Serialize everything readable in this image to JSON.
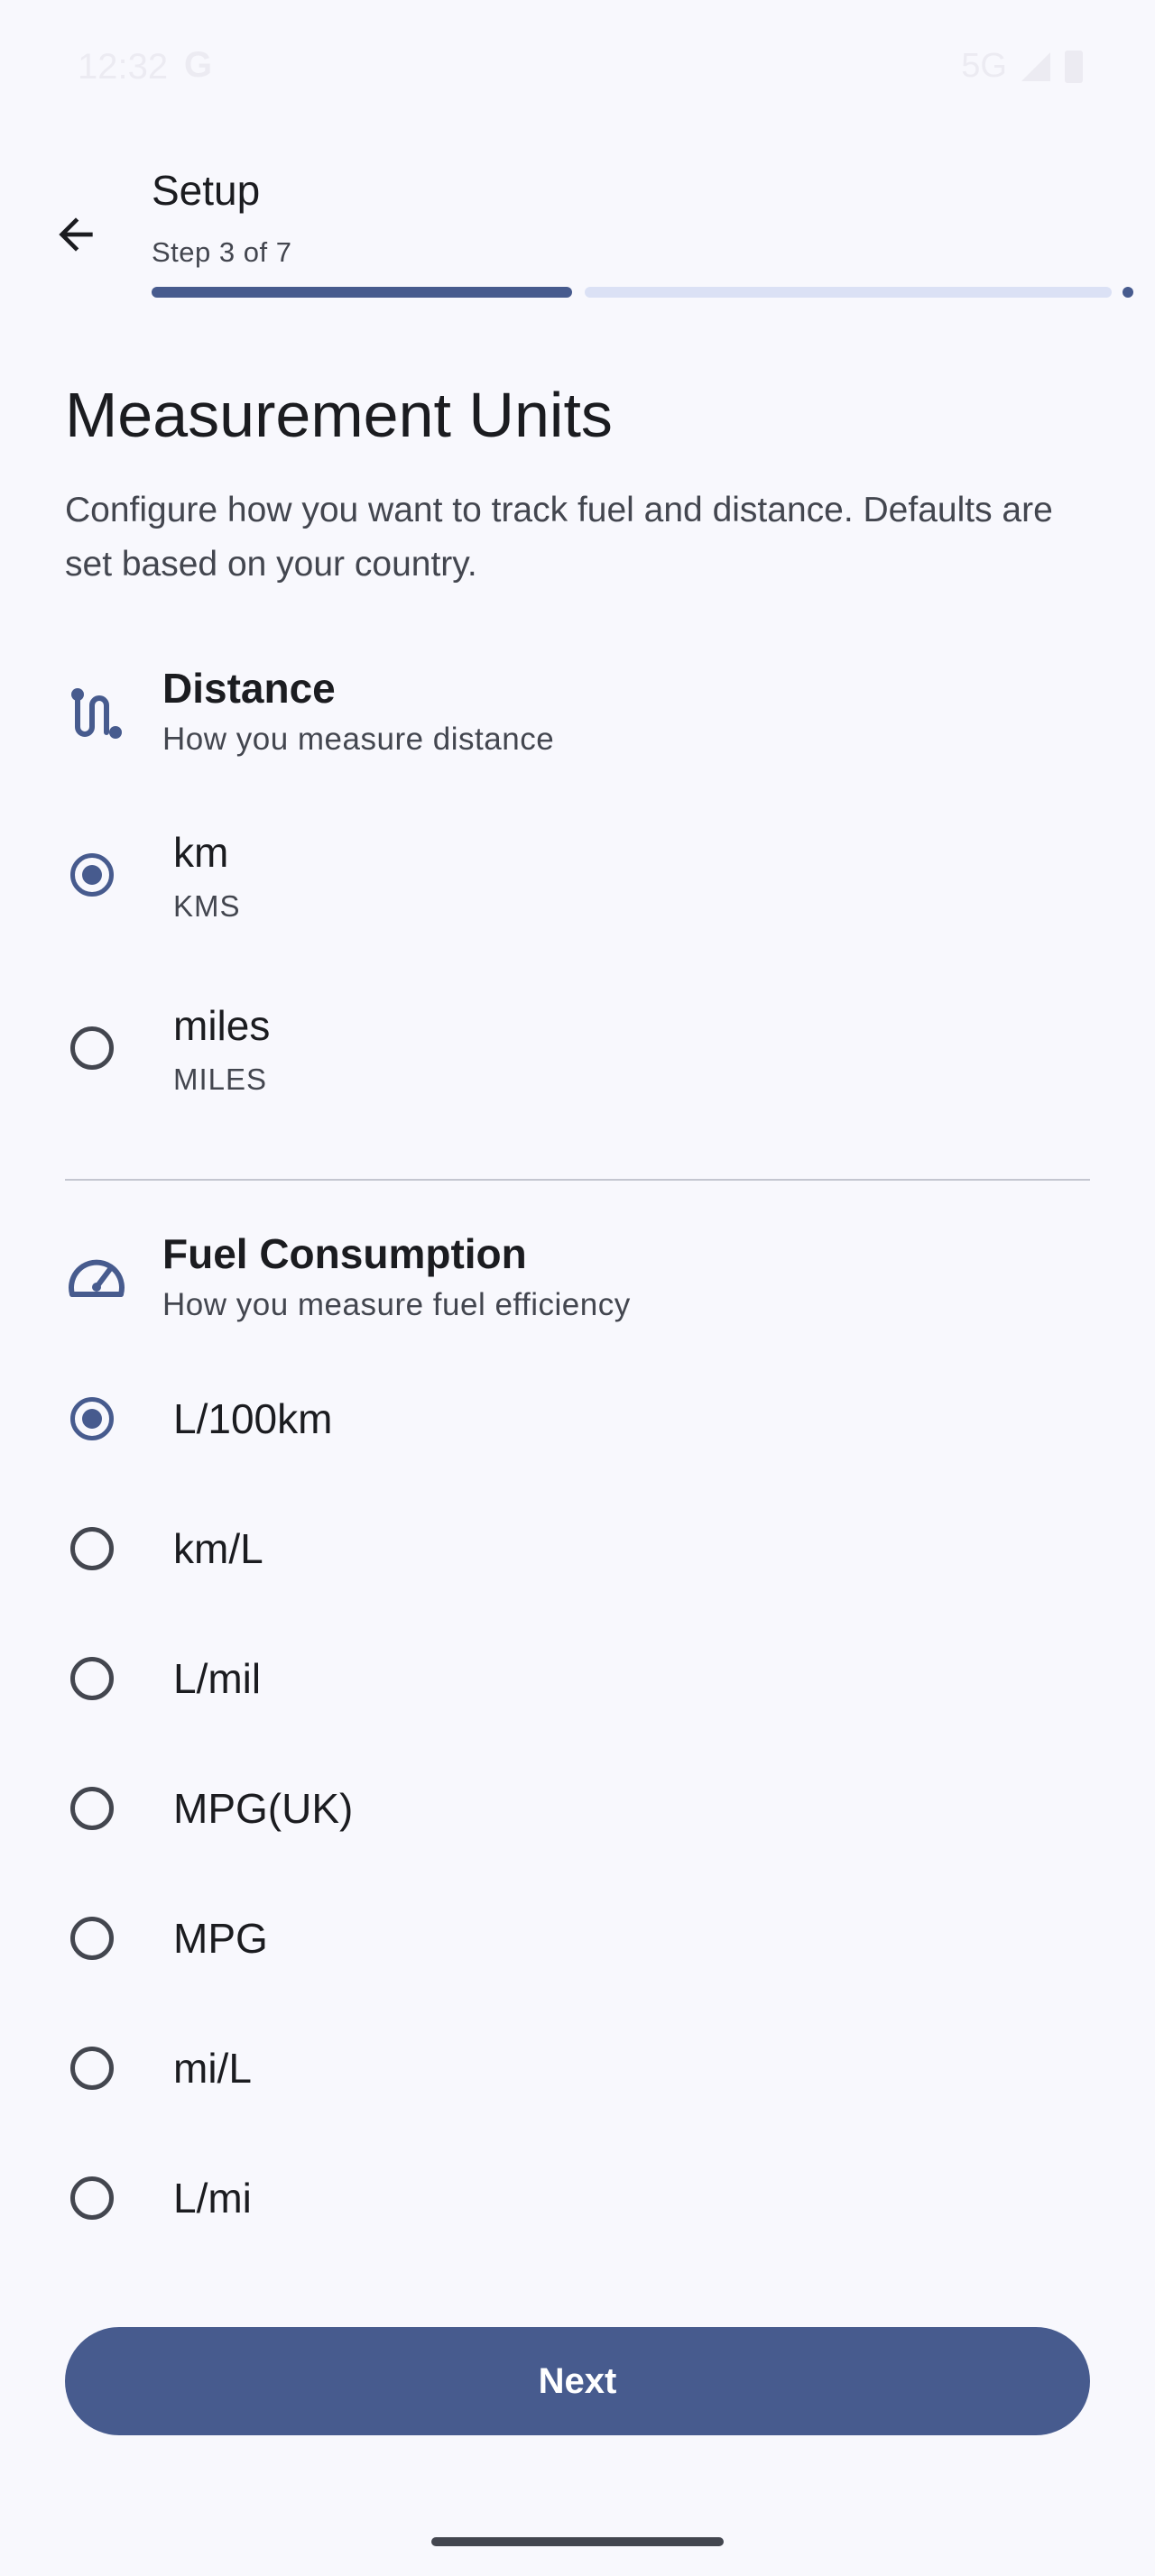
{
  "status_bar": {
    "time": "12:32",
    "google_glyph": "G",
    "network": "5G",
    "icons": [
      "signal-icon",
      "battery-icon"
    ]
  },
  "header": {
    "title": "Setup",
    "step_text": "Step 3 of 7",
    "progress": {
      "current": 3,
      "total": 7
    },
    "back_icon": "arrow-back-icon"
  },
  "page": {
    "title": "Measurement Units",
    "description": "Configure how you want to track fuel and distance. Defaults are set based on your country."
  },
  "distance": {
    "icon": "route-icon",
    "title": "Distance",
    "subtitle": "How you measure distance",
    "options": [
      {
        "label": "km",
        "sublabel": "KMS",
        "selected": true
      },
      {
        "label": "miles",
        "sublabel": "MILES",
        "selected": false
      }
    ]
  },
  "fuel": {
    "icon": "speedometer-icon",
    "title": "Fuel Consumption",
    "subtitle": "How you measure fuel efficiency",
    "options": [
      {
        "label": "L/100km",
        "selected": true
      },
      {
        "label": "km/L",
        "selected": false
      },
      {
        "label": "L/mil",
        "selected": false
      },
      {
        "label": "MPG(UK)",
        "selected": false
      },
      {
        "label": "MPG",
        "selected": false
      },
      {
        "label": "mi/L",
        "selected": false
      },
      {
        "label": "L/mi",
        "selected": false
      }
    ]
  },
  "actions": {
    "next_label": "Next"
  },
  "colors": {
    "primary": "#475b8e",
    "background": "#f8f8fd",
    "track": "#dbe1f5",
    "text": "#1b1c20",
    "secondary_text": "#43464f"
  }
}
